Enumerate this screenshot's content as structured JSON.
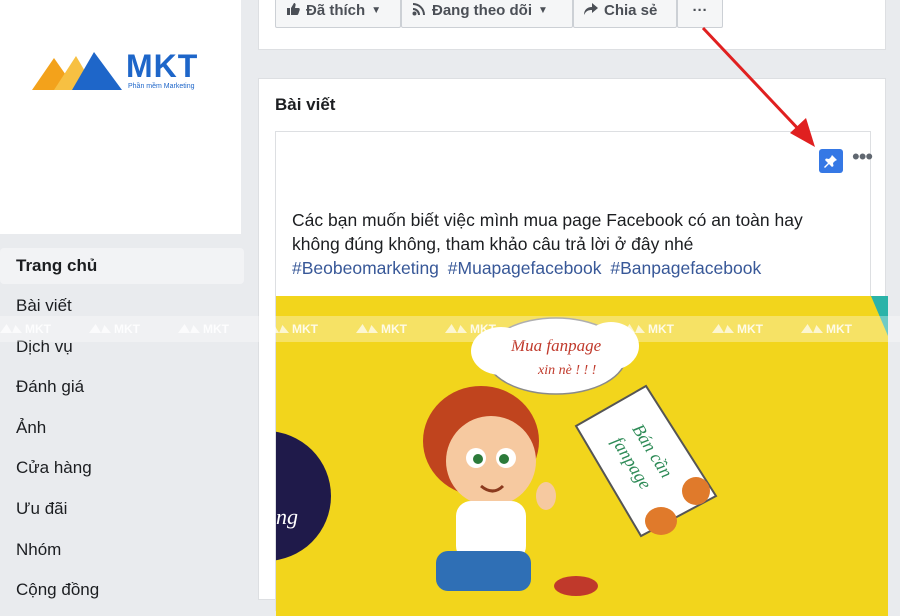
{
  "brand": {
    "name": "MKT",
    "tagline": "Phần mềm Marketing"
  },
  "page_actions": [
    {
      "label": "Đã thích",
      "icon": "like-icon"
    },
    {
      "label": "Đang theo dõi",
      "icon": "rss-icon"
    },
    {
      "label": "Chia sẻ",
      "icon": "share-icon"
    },
    {
      "label": "···",
      "icon": "more-icon"
    }
  ],
  "sidebar": {
    "items": [
      {
        "label": "Trang chủ",
        "active": true
      },
      {
        "label": "Bài viết"
      },
      {
        "label": "Dịch vụ"
      },
      {
        "label": "Đánh giá"
      },
      {
        "label": "Ảnh"
      },
      {
        "label": "Cửa hàng"
      },
      {
        "label": "Ưu đãi"
      },
      {
        "label": "Nhóm"
      },
      {
        "label": "Cộng đồng"
      }
    ]
  },
  "posts": {
    "title": "Bài viết",
    "pinned_post": {
      "text_line1": "Các bạn muốn biết việc mình mua page Facebook có an toàn hay",
      "text_line2": "không đúng không, tham khảo câu trả lời ở đây nhé",
      "hashtags": [
        "#Beobeomarketing",
        "#Muapagefacebook",
        "#Banpagefacebook"
      ],
      "image": {
        "cloud_text_line1": "Mua fanpage",
        "cloud_text_line2": "xin nè ! ! !",
        "sign_text_line1": "Bán cần",
        "sign_text_line2": "fanpage",
        "edge_text": "ng"
      }
    }
  },
  "watermark": {
    "text": "MKT"
  },
  "colors": {
    "accent": "#3578e5",
    "hashtag": "#385898",
    "image_bg": "#f2d51c",
    "arrow": "#e02020"
  }
}
